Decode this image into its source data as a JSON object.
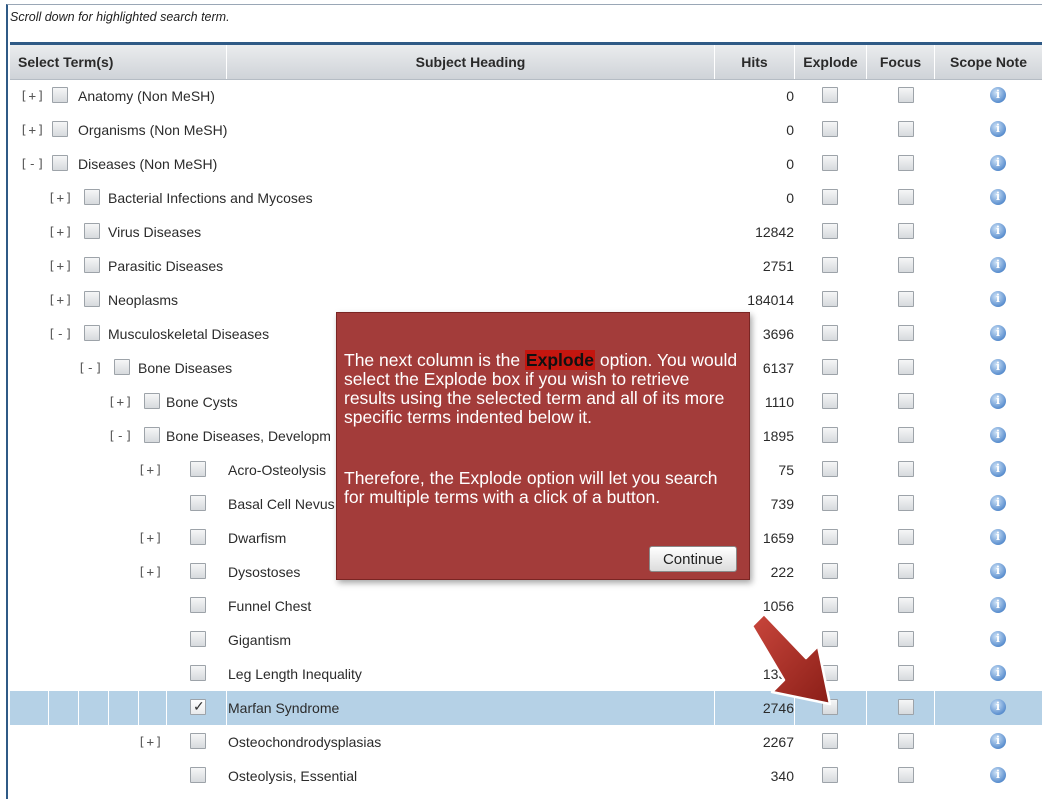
{
  "note": "Scroll down for highlighted search term.",
  "header": {
    "select": "Select Term(s)",
    "subject": "Subject Heading",
    "hits": "Hits",
    "explode": "Explode",
    "focus": "Focus",
    "scope": "Scope Note"
  },
  "rows": [
    {
      "toggle": "[+]",
      "term": "Anatomy (Non MeSH)",
      "hits": "0",
      "depth": 0
    },
    {
      "toggle": "[+]",
      "term": "Organisms (Non MeSH)",
      "hits": "0",
      "depth": 0
    },
    {
      "toggle": "[-]",
      "term": "Diseases (Non MeSH)",
      "hits": "0",
      "depth": 0
    },
    {
      "toggle": "[+]",
      "term": "Bacterial Infections and Mycoses",
      "hits": "0",
      "depth": 1
    },
    {
      "toggle": "[+]",
      "term": "Virus Diseases",
      "hits": "12842",
      "depth": 1
    },
    {
      "toggle": "[+]",
      "term": "Parasitic Diseases",
      "hits": "2751",
      "depth": 1
    },
    {
      "toggle": "[+]",
      "term": "Neoplasms",
      "hits": "184014",
      "depth": 1
    },
    {
      "toggle": "[-]",
      "term": "Musculoskeletal Diseases",
      "hits": "3696",
      "depth": 1
    },
    {
      "toggle": "[-]",
      "term": "Bone Diseases",
      "hits": "6137",
      "depth": 2
    },
    {
      "toggle": "[+]",
      "term": "Bone Cysts",
      "hits": "1110",
      "depth": 3
    },
    {
      "toggle": "[-]",
      "term": "Bone Diseases, Developm",
      "hits": "1895",
      "depth": 3
    },
    {
      "toggle": "[+]",
      "term": "Acro-Osteolysis",
      "hits": "75",
      "depth": 4
    },
    {
      "toggle": "",
      "term": "Basal Cell Nevus",
      "hits": "739",
      "depth": 4
    },
    {
      "toggle": "[+]",
      "term": "Dwarfism",
      "hits": "1659",
      "depth": 4
    },
    {
      "toggle": "[+]",
      "term": "Dysostoses",
      "hits": "222",
      "depth": 4
    },
    {
      "toggle": "",
      "term": "Funnel Chest",
      "hits": "1056",
      "depth": 4
    },
    {
      "toggle": "",
      "term": "Gigantism",
      "hits": "",
      "depth": 4
    },
    {
      "toggle": "",
      "term": "Leg Length Inequality",
      "hits": "1354",
      "depth": 4
    },
    {
      "toggle": "",
      "term": "Marfan Syndrome",
      "hits": "2746",
      "depth": 4,
      "selected": true
    },
    {
      "toggle": "[+]",
      "term": "Osteochondrodysplasias",
      "hits": "2267",
      "depth": 4
    },
    {
      "toggle": "",
      "term": "Osteolysis, Essential",
      "hits": "340",
      "depth": 4
    }
  ],
  "popup": {
    "line1_pre": "The next column is the ",
    "line1_hl": "Explode",
    "line1_post": " option.  You would select the Explode box if you wish to retrieve results using the selected term and all of its more specific terms indented below it.",
    "line2": "Therefore, the Explode option will let you search for multiple terms with a click of a button.",
    "continue": "Continue"
  },
  "scope_icon": "i",
  "colors": {
    "popup_bg": "#a33c3a",
    "highlight": "#c4160f",
    "selected_row": "#b5d1e6",
    "arrow": "#a52a22"
  },
  "icons": {
    "scope": "info-icon",
    "arrow": "red-arrow-pointer"
  }
}
